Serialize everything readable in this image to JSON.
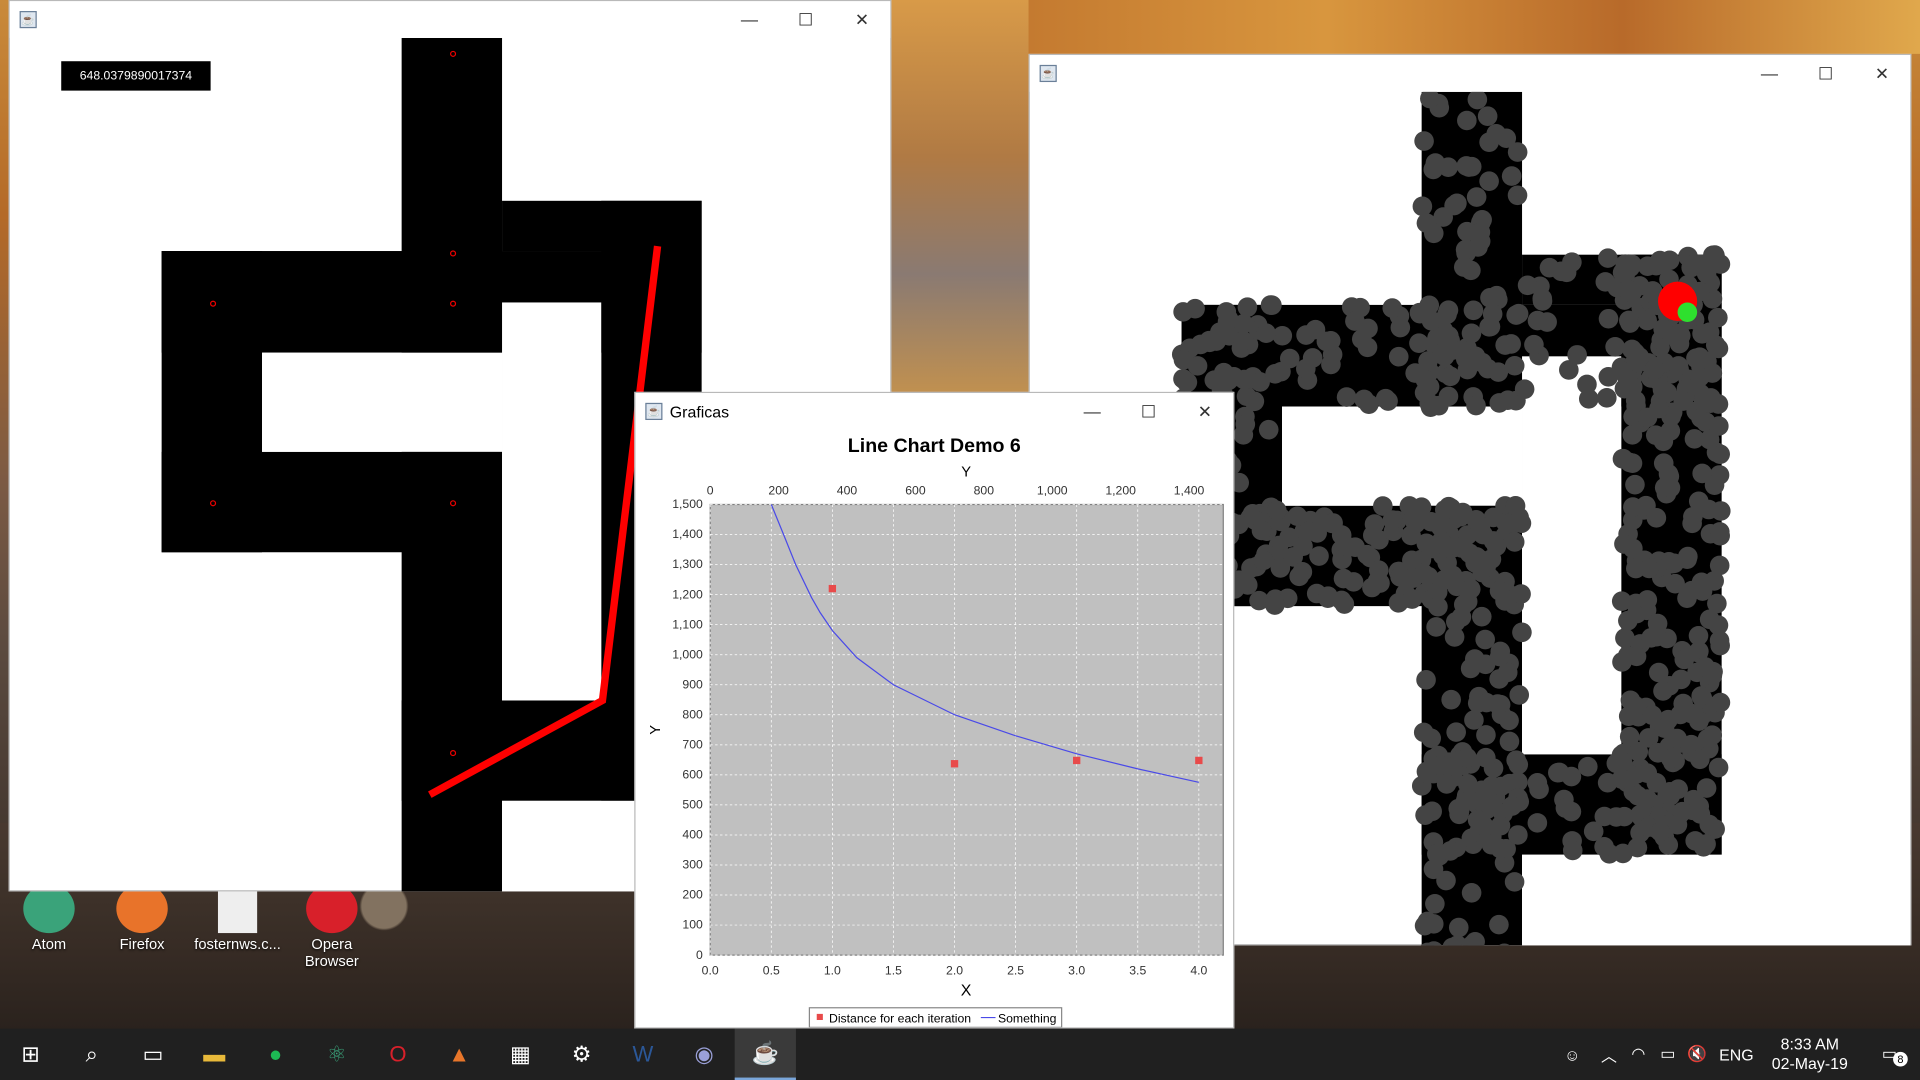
{
  "left_window": {
    "distance_readout": "648.0379890017374"
  },
  "right_window": {},
  "chart_window": {
    "title": "Graficas"
  },
  "chart_data": {
    "type": "line",
    "title": "Line Chart Demo 6",
    "xlabel": "X",
    "ylabel": "Y",
    "top_axis_label": "Y",
    "x_ticks": [
      "0.0",
      "0.5",
      "1.0",
      "1.5",
      "2.0",
      "2.5",
      "3.0",
      "3.5",
      "4.0"
    ],
    "y_ticks": [
      "0",
      "100",
      "200",
      "300",
      "400",
      "500",
      "600",
      "700",
      "800",
      "900",
      "1,000",
      "1,100",
      "1,200",
      "1,300",
      "1,400",
      "1,500"
    ],
    "top_ticks": [
      "0",
      "200",
      "400",
      "600",
      "800",
      "1,000",
      "1,200",
      "1,400"
    ],
    "xlim": [
      0,
      4.2
    ],
    "ylim": [
      0,
      1500
    ],
    "top_lim": [
      0,
      1500
    ],
    "grid": true,
    "legend_position": "bottom",
    "series": [
      {
        "name": "Distance for each iteration",
        "kind": "points",
        "color": "#e84a4a",
        "x": [
          1.0,
          2.0,
          3.0,
          4.0
        ],
        "y": [
          1220,
          637,
          648,
          648
        ]
      },
      {
        "name": "Something",
        "kind": "line",
        "color": "#4a4ae8",
        "x": [
          0.5,
          0.6,
          0.7,
          0.83,
          0.9,
          1.0,
          1.2,
          1.5,
          2.0,
          2.5,
          3.0,
          3.5,
          4.0
        ],
        "y": [
          1500,
          1400,
          1300,
          1190,
          1140,
          1080,
          990,
          900,
          800,
          730,
          670,
          620,
          575
        ]
      }
    ]
  },
  "desktop_icons": [
    {
      "label": "Atom",
      "color": "#3aa37a"
    },
    {
      "label": "Firefox",
      "color": "#e8732a"
    },
    {
      "label": "fosternws.c...",
      "color": "#e0e0e0"
    },
    {
      "label": "Opera Browser",
      "color": "#d8202a"
    }
  ],
  "taskbar": {
    "items": [
      "windows-start",
      "search",
      "task-view",
      "file-explorer",
      "spotify",
      "atom",
      "opera",
      "matlab",
      "calculator",
      "settings",
      "word",
      "eclipse",
      "java"
    ],
    "lang": "ENG",
    "time": "8:33 AM",
    "date": "02-May-19",
    "notifications": "8"
  }
}
